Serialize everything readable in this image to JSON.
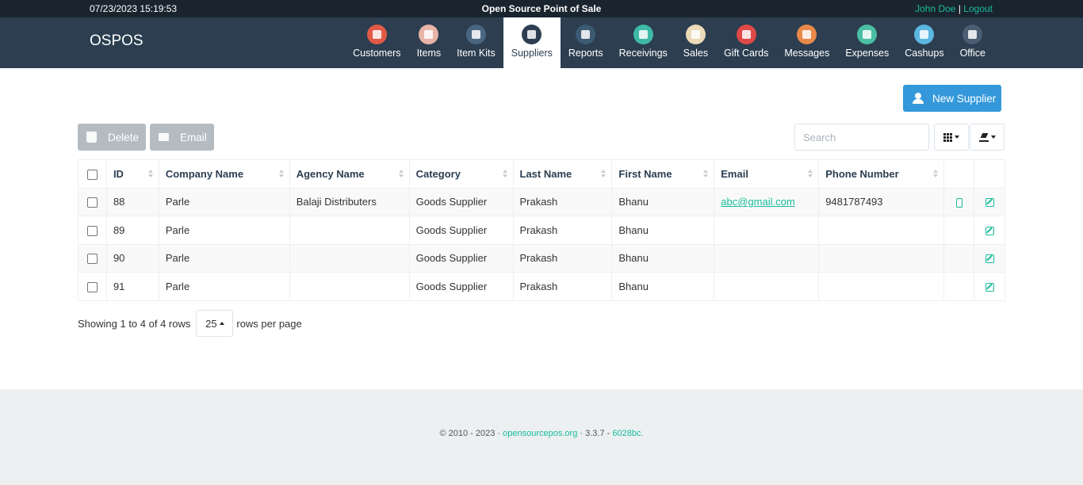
{
  "topbar": {
    "datetime": "07/23/2023 15:19:53",
    "app_title": "Open Source Point of Sale",
    "user": "John Doe",
    "separator": "|",
    "logout": "Logout"
  },
  "brand": "OSPOS",
  "nav": [
    {
      "label": "Customers",
      "icon": "customers-icon",
      "color": "#e15a47"
    },
    {
      "label": "Items",
      "icon": "items-icon",
      "color": "#e8b4a8"
    },
    {
      "label": "Item Kits",
      "icon": "item-kits-icon",
      "color": "#4a6580"
    },
    {
      "label": "Suppliers",
      "icon": "suppliers-icon",
      "color": "#2c3e50"
    },
    {
      "label": "Reports",
      "icon": "reports-icon",
      "color": "#3d5a74"
    },
    {
      "label": "Receivings",
      "icon": "receivings-icon",
      "color": "#3fb9a6"
    },
    {
      "label": "Sales",
      "icon": "sales-icon",
      "color": "#ecd9b8"
    },
    {
      "label": "Gift Cards",
      "icon": "gift-cards-icon",
      "color": "#e04848"
    },
    {
      "label": "Messages",
      "icon": "messages-icon",
      "color": "#e8894a"
    },
    {
      "label": "Expenses",
      "icon": "expenses-icon",
      "color": "#4bbfa3"
    },
    {
      "label": "Cashups",
      "icon": "cashups-icon",
      "color": "#5bb6e0"
    },
    {
      "label": "Office",
      "icon": "office-icon",
      "color": "#4a5e73"
    }
  ],
  "active_nav": "Suppliers",
  "toolbar": {
    "new_supplier": "New Supplier",
    "delete": "Delete",
    "email": "Email",
    "search_placeholder": "Search"
  },
  "table": {
    "columns": [
      "ID",
      "Company Name",
      "Agency Name",
      "Category",
      "Last Name",
      "First Name",
      "Email",
      "Phone Number"
    ],
    "rows": [
      {
        "id": "88",
        "company": "Parle",
        "agency": "Balaji Distributers",
        "category": "Goods Supplier",
        "last": "Prakash",
        "first": "Bhanu",
        "email": "abc@gmail.com",
        "phone": "9481787493"
      },
      {
        "id": "89",
        "company": "Parle",
        "agency": "",
        "category": "Goods Supplier",
        "last": "Prakash",
        "first": "Bhanu",
        "email": "",
        "phone": ""
      },
      {
        "id": "90",
        "company": "Parle",
        "agency": "",
        "category": "Goods Supplier",
        "last": "Prakash",
        "first": "Bhanu",
        "email": "",
        "phone": ""
      },
      {
        "id": "91",
        "company": "Parle",
        "agency": "",
        "category": "Goods Supplier",
        "last": "Prakash",
        "first": "Bhanu",
        "email": "",
        "phone": ""
      }
    ]
  },
  "pagination": {
    "showing": "Showing 1 to 4 of 4 rows",
    "page_size": "25",
    "rows_per_page": "rows per page"
  },
  "footer": {
    "copyright": "© 2010 - 2023 ·",
    "site": "opensourcepos.org",
    "version": "· 3.3.7 -",
    "commit": "6028bc."
  },
  "colors": {
    "topbar": "#1a242f",
    "navbar": "#2c3e50",
    "accent": "#18bc9c",
    "primary_button": "#3498db",
    "disabled_button": "#b4bcc2",
    "footer_bg": "#ecf0f1"
  }
}
